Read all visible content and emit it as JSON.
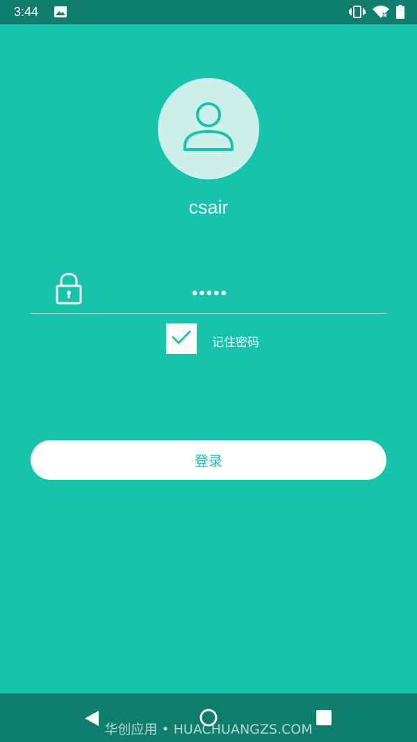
{
  "status_bar": {
    "time": "3:44",
    "icons": [
      "image-icon",
      "vibrate-icon",
      "wifi-x-icon",
      "battery-icon"
    ]
  },
  "profile": {
    "avatar_icon": "user-icon",
    "username": "csair"
  },
  "form": {
    "lock_icon": "lock-icon",
    "password_value": "•••••",
    "remember_checked": true,
    "remember_label": "记住密码",
    "login_label": "登录"
  },
  "nav_bar": {
    "buttons": [
      "back-icon",
      "home-icon",
      "recent-apps-icon"
    ],
    "watermark": "华创应用 • HUACHUANGZS.COM"
  },
  "colors": {
    "background": "#15c4aa",
    "bars": "#0f7e6c",
    "avatar_bg": "#cdf1ea",
    "accent": "#15c4aa"
  }
}
